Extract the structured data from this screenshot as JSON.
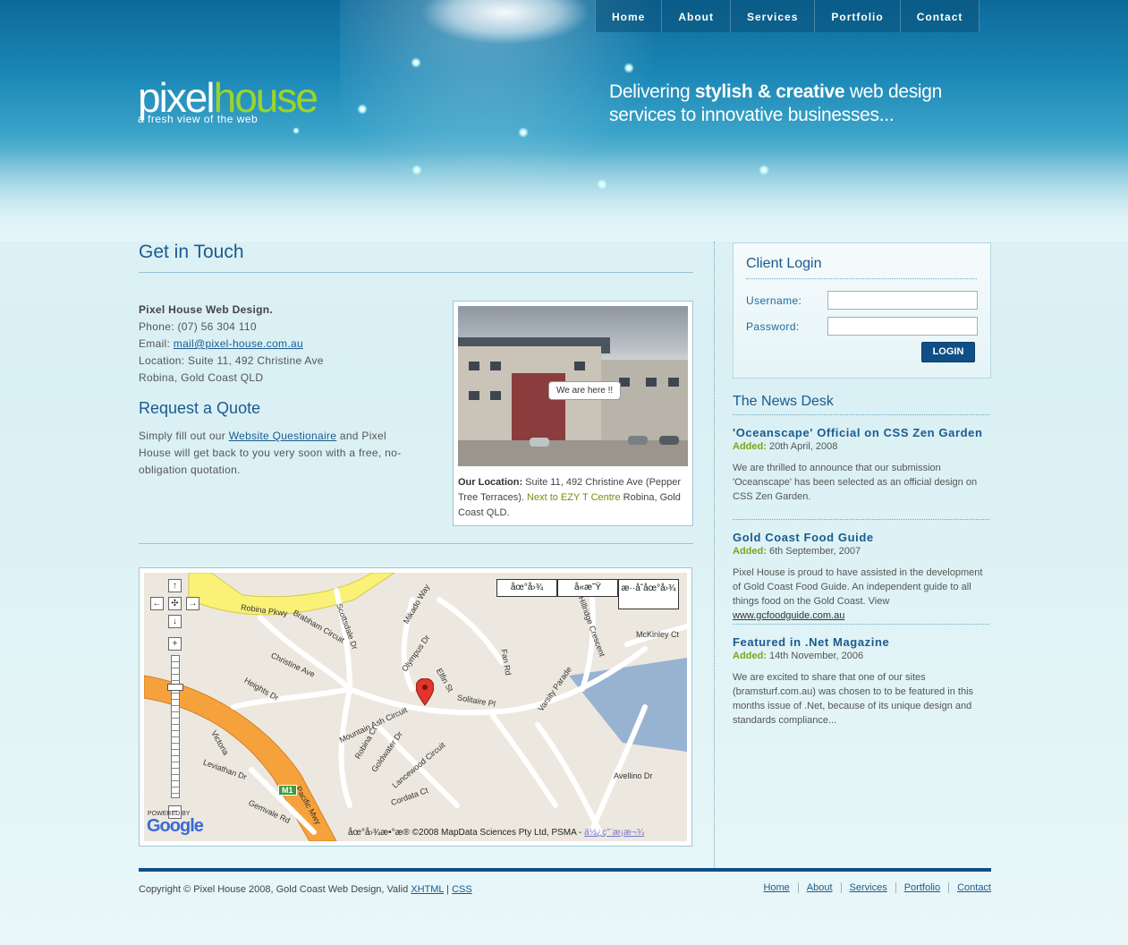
{
  "nav": [
    "Home",
    "About",
    "Services",
    "Portfolio",
    "Contact"
  ],
  "logo": {
    "part1": "pixel",
    "part2": "house",
    "tagline": "a fresh view of the web"
  },
  "slogan": {
    "pre": "Delivering ",
    "bold": "stylish & creative",
    "post": " web design",
    "line2": "services to innovative businesses..."
  },
  "get_in_touch": {
    "title": "Get in Touch",
    "company": "Pixel House Web Design.",
    "phone": "Phone: (07) 56 304 110",
    "email_label": "Email: ",
    "email": "mail@pixel-house.com.au",
    "location1": "Location: Suite 11, 492 Christine Ave",
    "location2": "Robina, Gold Coast QLD"
  },
  "quote": {
    "title": "Request a Quote",
    "pre": "Simply fill out our ",
    "link": "Website Questionaire",
    "post": " and Pixel House will get back to you very soon with a free, no-obligation quotation."
  },
  "photo": {
    "bubble": "We are here !!",
    "caption_label": "Our Location:",
    "caption_main": " Suite 11, 492 Christine Ave (Pepper Tree Terraces). ",
    "caption_highlight": "Next to EZY T Centre",
    "caption_end": " Robina, Gold Coast QLD."
  },
  "map": {
    "btn1": "åœ°å›¾",
    "btn2": "å«æ˜Ÿ",
    "btn3": "æ··åˆåœ°å›¾",
    "labels": [
      "Robina Pkwy",
      "Brabham Circuit",
      "Scottsdale Dr",
      "Mikado Way",
      "Olympus Dr",
      "Christine Ave",
      "Elfin St",
      "Fan Rd",
      "Varsity Parade",
      "Hillridge Crescent",
      "McKinley Ct",
      "Heights Dr",
      "Mountain Ash Circuit",
      "Robina Ct",
      "Goldwater Dr",
      "Lancewood Circuit",
      "Cordata Ct",
      "Avellino Dr",
      "Victoria",
      "Leviathan Dr",
      "Gemvale Rd",
      "Pacific Mwy",
      "M1",
      "Solitaire Pl"
    ],
    "powered": "POWERED BY",
    "google": "Google",
    "copyright": "åœ°å›¾æ•°æ® ©2008 MapData Sciences Pty Ltd, PSMA - ",
    "terms": "ä½¿ç”¨æ¡æ¬¾"
  },
  "login": {
    "title": "Client Login",
    "username_label": "Username:",
    "password_label": "Password:",
    "button": "LOGIN"
  },
  "news": {
    "title": "The News Desk",
    "added_label": "Added:",
    "items": [
      {
        "headline": "'Oceanscape' Official on CSS Zen Garden",
        "date": " 20th April, 2008",
        "body": "We are thrilled to announce that our submission 'Oceanscape' has been selected as an official design on CSS Zen Garden."
      },
      {
        "headline": "Gold Coast Food Guide",
        "date": " 6th September, 2007",
        "body": "Pixel House is proud to have assisted in the development of Gold Coast Food Guide. An independent guide to all things food on the Gold Coast. View ",
        "link": "www.gcfoodguide.com.au"
      },
      {
        "headline": "Featured in .Net Magazine",
        "date": " 14th November, 2006",
        "body": "We are excited to share that one of our sites (bramsturf.com.au) was chosen to to be featured in this months issue of .Net, because of its unique design and standards compliance..."
      }
    ]
  },
  "footer": {
    "copyright": "Copyright © Pixel House 2008, Gold Coast Web Design, Valid ",
    "xhtml": "XHTML",
    "sep": " | ",
    "css": "CSS",
    "nav": [
      "Home",
      "About",
      "Services",
      "Portfolio",
      "Contact"
    ]
  },
  "colors": {
    "brand_blue": "#1b5a8f",
    "brand_green": "#9ad52a",
    "nav_bg": "#0c6a9b",
    "button": "#0f4f86"
  }
}
